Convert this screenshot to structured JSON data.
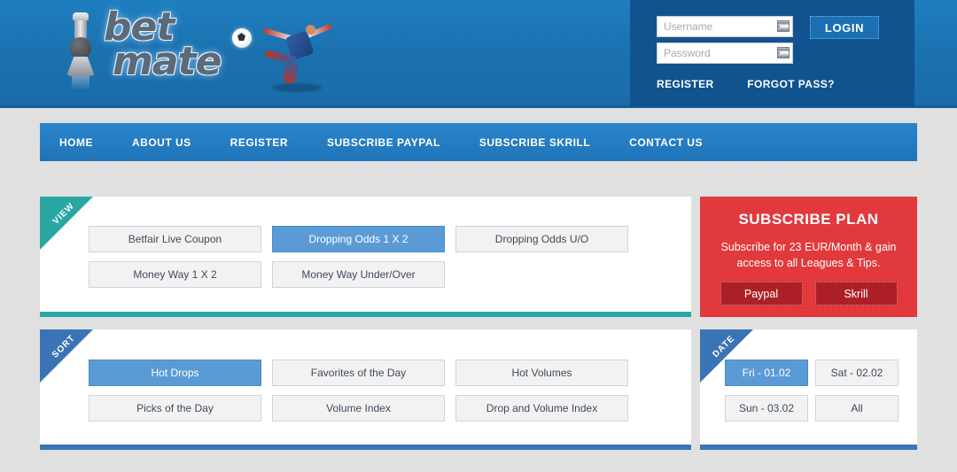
{
  "site": {
    "logo_line1": "bet",
    "logo_line2": "mate"
  },
  "login": {
    "username_placeholder": "Username",
    "username_value": "",
    "password_placeholder": "Password",
    "password_value": "",
    "login_button": "LOGIN",
    "register_link": "REGISTER",
    "forgot_link": "FORGOT PASS?"
  },
  "nav": {
    "items": [
      {
        "label": "HOME"
      },
      {
        "label": "ABOUT US"
      },
      {
        "label": "REGISTER"
      },
      {
        "label": "SUBSCRIBE PAYPAL"
      },
      {
        "label": "SUBSCRIBE SKRILL"
      },
      {
        "label": "CONTACT US"
      }
    ]
  },
  "view_panel": {
    "ribbon_label": "VIEW",
    "accent_color": "#2aa7a2",
    "options": [
      {
        "label": "Betfair Live Coupon",
        "active": false
      },
      {
        "label": "Dropping Odds 1 X 2",
        "active": true
      },
      {
        "label": "Dropping Odds U/O",
        "active": false
      },
      {
        "label": "Money Way 1 X 2",
        "active": false
      },
      {
        "label": "Money Way Under/Over",
        "active": false
      }
    ]
  },
  "sort_panel": {
    "ribbon_label": "SORT",
    "accent_color": "#3b74b4",
    "options": [
      {
        "label": "Hot Drops",
        "active": true
      },
      {
        "label": "Favorites of the Day",
        "active": false
      },
      {
        "label": "Hot Volumes",
        "active": false
      },
      {
        "label": "Picks of the Day",
        "active": false
      },
      {
        "label": "Volume Index",
        "active": false
      },
      {
        "label": "Drop and Volume Index",
        "active": false
      }
    ]
  },
  "subscribe_panel": {
    "title": "SUBSCRIBE PLAN",
    "description": "Subscribe for 23 EUR/Month & gain access to all Leagues & Tips.",
    "price": "23 EUR/Month",
    "accent_color": "#e1393c",
    "buttons": [
      {
        "label": "Paypal"
      },
      {
        "label": "Skrill"
      }
    ]
  },
  "date_panel": {
    "ribbon_label": "DATE",
    "accent_color": "#3b74b4",
    "options": [
      {
        "label": "Fri - 01.02",
        "active": true
      },
      {
        "label": "Sat - 02.02",
        "active": false
      },
      {
        "label": "Sun - 03.02",
        "active": false
      },
      {
        "label": "All",
        "active": false
      }
    ]
  }
}
